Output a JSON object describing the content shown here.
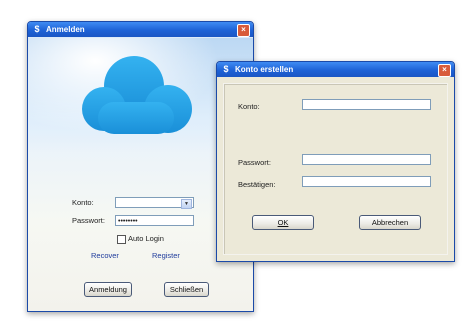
{
  "login": {
    "title": "Anmelden",
    "konto_label": "Konto:",
    "passwort_label": "Passwort:",
    "password_value": "••••••••",
    "auto_login_label": "Auto Login",
    "recover_link": "Recover",
    "register_link": "Register",
    "login_button": "Anmeldung",
    "close_button": "Schließen"
  },
  "konto_dialog": {
    "title": "Konto erstellen",
    "konto_label": "Konto:",
    "passwort_label": "Passwort:",
    "bestaetigen_label": "Bestätigen:",
    "ok_button": "OK",
    "cancel_button": "Abbrechen"
  },
  "icons": {
    "close": "close-icon",
    "app": "app-icon",
    "cloud": "cloud-icon",
    "dropdown": "chevron-down-icon"
  },
  "colors": {
    "titlebar": "#1e62d6",
    "cloud": "#1f9ae0",
    "link": "#1f3c9c",
    "dialog_bg": "#ece9d8"
  }
}
